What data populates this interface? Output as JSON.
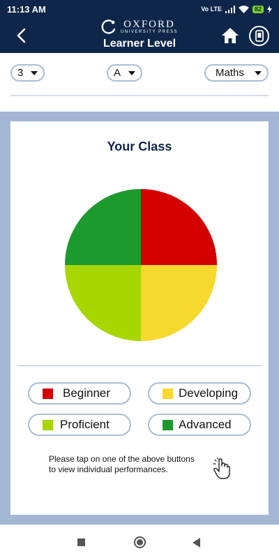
{
  "status_bar": {
    "time": "11:13 AM",
    "network_badge": "Vo LTE",
    "battery_level": "82"
  },
  "header": {
    "logo_main": "OXFORD",
    "logo_sub": "UNIVERSITY PRESS",
    "title": "Learner Level",
    "icons": [
      "back-arrow-icon",
      "home-icon",
      "phone-device-icon"
    ]
  },
  "filters": {
    "class_value": "3",
    "section_value": "A",
    "subject_value": "Maths"
  },
  "card": {
    "title": "Your Class"
  },
  "chart_data": {
    "type": "pie",
    "title": "Your Class",
    "categories": [
      "Beginner",
      "Developing",
      "Proficient",
      "Advanced"
    ],
    "values": [
      25,
      25,
      25,
      25
    ],
    "colors": [
      "#d40000",
      "#f7d82f",
      "#a8d600",
      "#1d9a2e"
    ],
    "start": "top",
    "direction": "clockwise"
  },
  "legend": [
    {
      "label": "Beginner",
      "color": "#d40000"
    },
    {
      "label": "Developing",
      "color": "#f7d82f"
    },
    {
      "label": "Proficient",
      "color": "#a8d600"
    },
    {
      "label": "Advanced",
      "color": "#1d9a2e"
    }
  ],
  "hint_text": "Please tap on one of the above buttons to view individual performances.",
  "colors": {
    "header_bg": "#0e2649",
    "main_bg": "#a3b7d4",
    "border": "#a9bdd4"
  }
}
